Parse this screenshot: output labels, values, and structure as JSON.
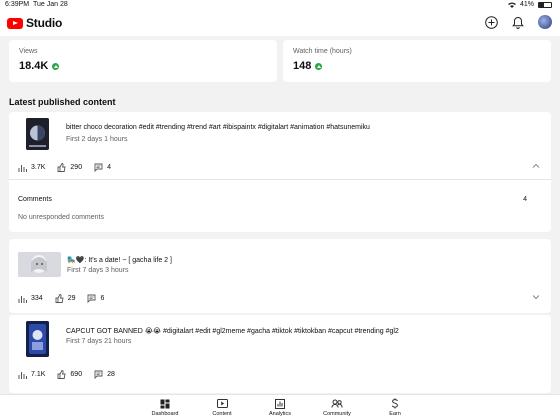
{
  "status_bar": {
    "time": "6:39PM",
    "date": "Tue Jan 28",
    "battery": "41%"
  },
  "app": {
    "logo_text": "Studio",
    "icons": [
      "add-icon",
      "bell-icon",
      "avatar"
    ]
  },
  "stats": [
    {
      "label": "Views",
      "value": "18.4K",
      "trend": "up"
    },
    {
      "label": "Watch time (hours)",
      "value": "148",
      "trend": "up"
    }
  ],
  "section_title": "Latest published content",
  "videos": [
    {
      "title": "bitter choco decoration #edit #trending #trend #art #ibispaintx #digitalart #animation #hatsunemiku",
      "meta": "First 2 days 1 hours",
      "views": "3.7K",
      "likes": "290",
      "comments": "4",
      "expanded": true,
      "comments_label": "Comments",
      "comments_count": "4",
      "no_unresponded": "No unresponded comments"
    },
    {
      "title": "🛼🖤: It's a date! ~ [ gacha life 2 ]",
      "meta": "First 7 days 3 hours",
      "views": "334",
      "likes": "29",
      "comments": "6",
      "expanded": false
    },
    {
      "title": "CAPCUT GOT BANNED 😭😭 #digitalart #edit #gl2meme #gacha #tiktok #tiktokban #capcut #trending #gl2",
      "meta": "First 7 days 21 hours",
      "views": "7.1K",
      "likes": "690",
      "comments": "28",
      "expanded": false
    }
  ],
  "nav": [
    {
      "label": "Dashboard",
      "icon": "dashboard-icon",
      "active": true
    },
    {
      "label": "Content",
      "icon": "content-icon",
      "active": false
    },
    {
      "label": "Analytics",
      "icon": "analytics-icon",
      "active": false
    },
    {
      "label": "Community",
      "icon": "community-icon",
      "active": false
    },
    {
      "label": "Earn",
      "icon": "earn-icon",
      "active": false
    }
  ],
  "colors": {
    "youtube_red": "#ff0000",
    "trend_up": "#2ba640",
    "background": "#f2f2f2"
  }
}
